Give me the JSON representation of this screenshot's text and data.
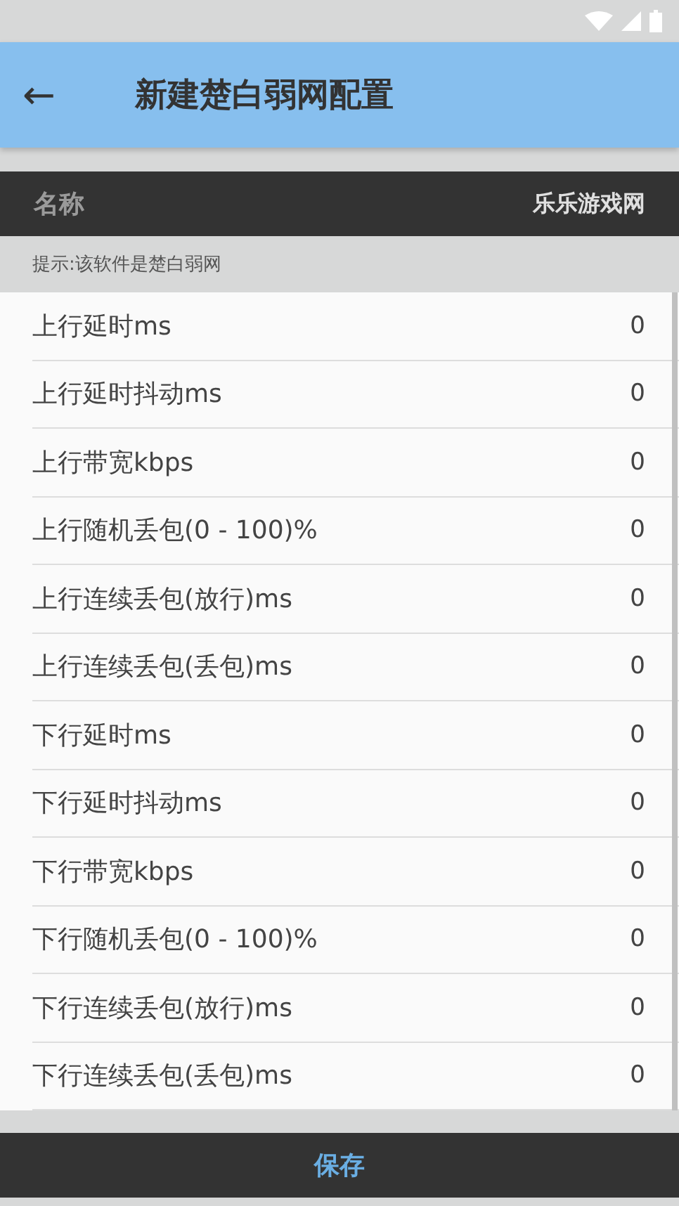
{
  "app_bar": {
    "back": "←",
    "title": "新建楚白弱网配置"
  },
  "name_field": {
    "label": "名称",
    "value": "乐乐游戏网"
  },
  "hint": "提示:该软件是楚白弱网",
  "settings": [
    {
      "label": "上行延时ms",
      "value": "0"
    },
    {
      "label": "上行延时抖动ms",
      "value": "0"
    },
    {
      "label": "上行带宽kbps",
      "value": "0"
    },
    {
      "label": "上行随机丢包(0 - 100)%",
      "value": "0"
    },
    {
      "label": "上行连续丢包(放行)ms",
      "value": "0"
    },
    {
      "label": "上行连续丢包(丢包)ms",
      "value": "0"
    },
    {
      "label": "下行延时ms",
      "value": "0"
    },
    {
      "label": "下行延时抖动ms",
      "value": "0"
    },
    {
      "label": "下行带宽kbps",
      "value": "0"
    },
    {
      "label": "下行随机丢包(0 - 100)%",
      "value": "0"
    },
    {
      "label": "下行连续丢包(放行)ms",
      "value": "0"
    },
    {
      "label": "下行连续丢包(丢包)ms",
      "value": "0"
    }
  ],
  "save_button": "保存"
}
